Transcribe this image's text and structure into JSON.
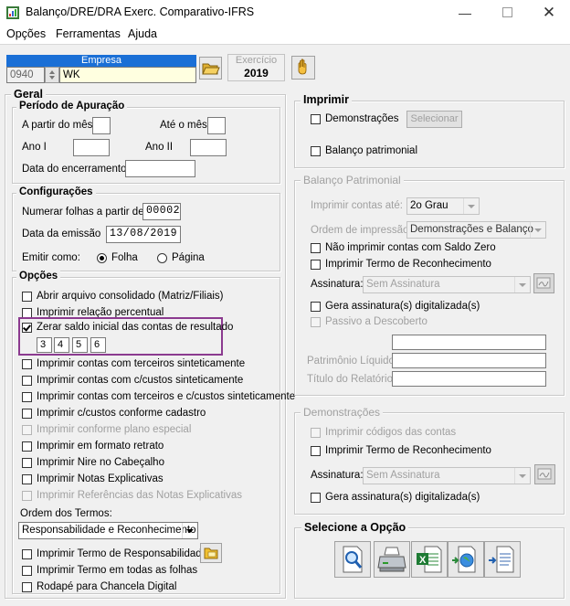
{
  "window": {
    "title": "Balanço/DRE/DRA Exerc. Comparativo-IFRS"
  },
  "menu": {
    "opcoes": "Opções",
    "ferramentas": "Ferramentas",
    "ajuda": "Ajuda"
  },
  "empresa": {
    "label": "Empresa",
    "code": "0940",
    "name": "WK"
  },
  "exercicio": {
    "label": "Exercício",
    "year": "2019"
  },
  "geral": {
    "title": "Geral",
    "periodo": {
      "title": "Período de Apuração",
      "a_partir": "A partir do mês",
      "ate_mes": "Até o mês",
      "ano1": "Ano I",
      "ano2": "Ano II",
      "encerramento": "Data do encerramento"
    },
    "config": {
      "title": "Configurações",
      "numerar_label": "Numerar folhas a partir de",
      "numerar_value": "00002",
      "emissao_label": "Data da emissão",
      "emissao_value": "13/08/2019",
      "emitir_label": "Emitir como:",
      "folha": "Folha",
      "pagina": "Página"
    },
    "opcoes": {
      "title": "Opções",
      "abrir": "Abrir arquivo consolidado (Matriz/Filiais)",
      "imprimir_relacao": "Imprimir relação percentual",
      "zerar": "Zerar saldo inicial das contas de resultado",
      "digits": [
        "3",
        "4",
        "5",
        "6"
      ],
      "list": [
        "Imprimir contas com terceiros sinteticamente",
        "Imprimir contas com c/custos sinteticamente",
        "Imprimir contas com terceiros e c/custos sinteticamente",
        "Imprimir c/custos conforme cadastro",
        "Imprimir conforme plano especial",
        "Imprimir em formato retrato",
        "Imprimir Nire no Cabeçalho",
        "Imprimir Notas Explicativas",
        "Imprimir Referências das Notas Explicativas"
      ],
      "ordem_label": "Ordem dos Termos:",
      "ordem_value": "Responsabilidade e Reconhecimento",
      "termo_resp": "Imprimir Termo de Responsabilidade",
      "termo_todas": "Imprimir Termo em todas as folhas",
      "rodape": "Rodapé para Chancela Digital"
    }
  },
  "imprimir": {
    "title": "Imprimir",
    "demonstracoes": "Demonstrações",
    "selecionar": "Selecionar",
    "balanco": "Balanço patrimonial"
  },
  "balanco": {
    "title": "Balanço Patrimonial",
    "contas_label": "Imprimir contas até:",
    "contas_value": "2o Grau",
    "ordem_label": "Ordem de impressão:",
    "ordem_value": "Demonstrações e Balanço",
    "nao_imprimir": "Não imprimir contas com Saldo Zero",
    "termo_rec": "Imprimir Termo de Reconhecimento",
    "assinatura_label": "Assinatura:",
    "assinatura_value": "Sem Assinatura",
    "gera": "Gera assinatura(s) digitalizada(s)",
    "passivo": "Passivo a Descoberto",
    "patrimonio": "Patrimônio Líquido:",
    "titulo": "Título do Relatório:"
  },
  "demonstracoes": {
    "title": "Demonstrações",
    "codigos": "Imprimir códigos das contas",
    "termo_rec": "Imprimir Termo de Reconhecimento",
    "assinatura_label": "Assinatura:",
    "assinatura_value": "Sem Assinatura",
    "gera": "Gera assinatura(s) digitalizada(s)"
  },
  "selecione": {
    "title": "Selecione a Opção"
  }
}
